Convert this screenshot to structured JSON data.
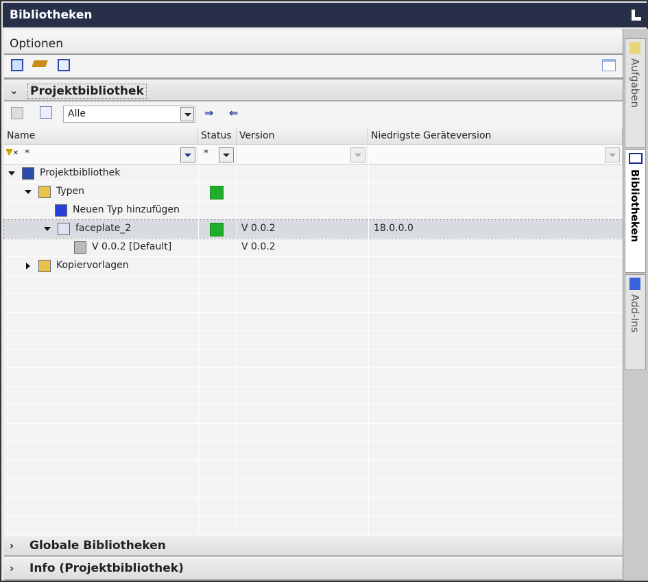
{
  "window": {
    "title": "Bibliotheken"
  },
  "options": {
    "label": "Optionen"
  },
  "project_library": {
    "section_label": "Projektbibliothek",
    "filter_combo": "Alle",
    "columns": [
      "Name",
      "Status",
      "Version",
      "Niedrigste Geräteversion"
    ],
    "filter_row": {
      "name": "*",
      "status": "*"
    },
    "tree": [
      {
        "label": "Projektbibliothek",
        "status": "",
        "version": "",
        "min_device": ""
      },
      {
        "label": "Typen",
        "status": "green",
        "version": "",
        "min_device": ""
      },
      {
        "label": "Neuen Typ hinzufügen",
        "status": "",
        "version": "",
        "min_device": ""
      },
      {
        "label": "faceplate_2",
        "status": "green",
        "version": "V 0.0.2",
        "min_device": "18.0.0.0"
      },
      {
        "label": "V 0.0.2 [Default]",
        "status": "",
        "version": "V 0.0.2",
        "min_device": ""
      },
      {
        "label": "Kopiervorlagen",
        "status": "",
        "version": "",
        "min_device": ""
      }
    ]
  },
  "sections": {
    "global": "Globale Bibliotheken",
    "info": "Info (Projektbibliothek)"
  },
  "sidebar": {
    "tabs": [
      "Aufgaben",
      "Bibliotheken",
      "Add-Ins"
    ]
  },
  "colors": {
    "titlebar": "#283049",
    "status_ok": "#1fae2a",
    "selected_row": "#d8dbe0"
  }
}
